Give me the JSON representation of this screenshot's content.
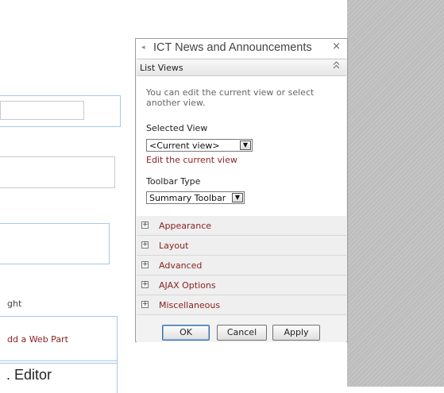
{
  "page": {
    "fragment_text_right": "ght",
    "fragment_link": "dd a Web Part",
    "fragment_heading": ". Editor"
  },
  "toolpane": {
    "title": "ICT News and Announcements",
    "close_glyph": "×",
    "collapse_left_glyph": "◂",
    "list_views": {
      "title": "List Views",
      "collapse_glyph": "⌃⌃",
      "description": "You can edit the current view or select another view.",
      "selected_view_label": "Selected View",
      "selected_view_value": "<Current view>",
      "edit_link": "Edit the current view",
      "toolbar_type_label": "Toolbar Type",
      "toolbar_type_value": "Summary Toolbar"
    },
    "categories": [
      {
        "label": "Appearance"
      },
      {
        "label": "Layout"
      },
      {
        "label": "Advanced"
      },
      {
        "label": "AJAX Options"
      },
      {
        "label": "Miscellaneous"
      }
    ],
    "expand_glyph": "+",
    "dropdown_glyph": "▼",
    "buttons": {
      "ok": "OK",
      "cancel": "Cancel",
      "apply": "Apply"
    }
  }
}
